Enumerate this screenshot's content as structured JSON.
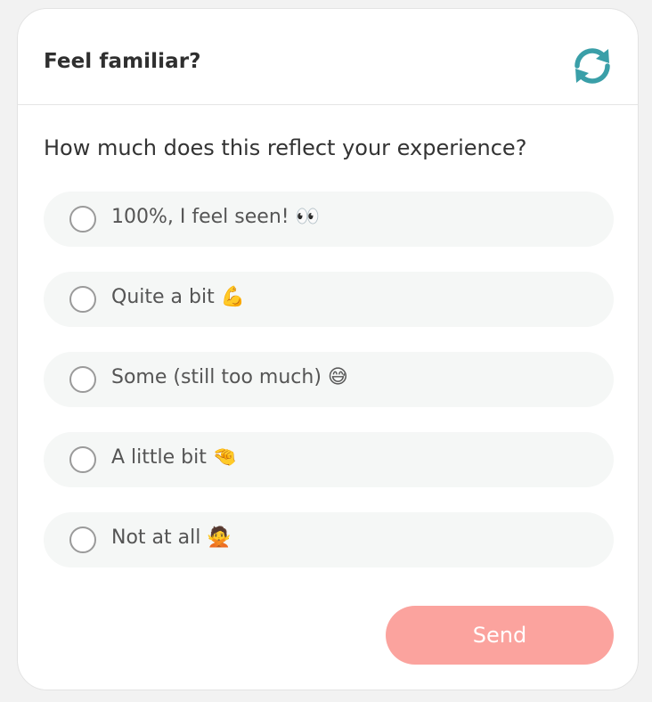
{
  "header": {
    "title": "Feel familiar?",
    "refresh_icon": "refresh-icon"
  },
  "question": "How much does this reflect your experience?",
  "options": [
    {
      "label": "100%, I feel seen! 👀",
      "selected": false
    },
    {
      "label": "Quite a bit 💪",
      "selected": false
    },
    {
      "label": "Some (still too much) 😅",
      "selected": false
    },
    {
      "label": "A little bit 🤏",
      "selected": false
    },
    {
      "label": "Not at all 🙅",
      "selected": false
    }
  ],
  "send_label": "Send",
  "colors": {
    "accent": "#3a9fa8",
    "send_button": "#fba39e",
    "option_bg": "#f5f7f6"
  }
}
